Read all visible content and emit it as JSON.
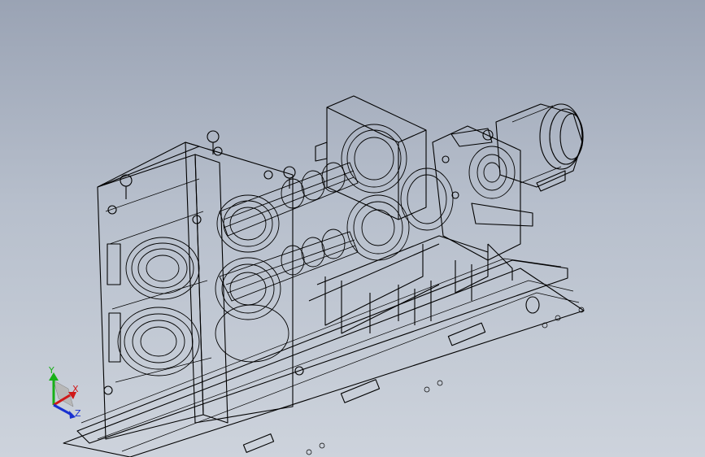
{
  "triad": {
    "x_label": "X",
    "y_label": "Y",
    "z_label": "Z",
    "x_color": "#d01818",
    "y_color": "#18b018",
    "z_color": "#1830d0"
  },
  "background": {
    "top_color": "#9aa3b4",
    "bottom_color": "#cdd3dc"
  },
  "model": {
    "render_mode": "wireframe",
    "line_color": "#000000"
  }
}
